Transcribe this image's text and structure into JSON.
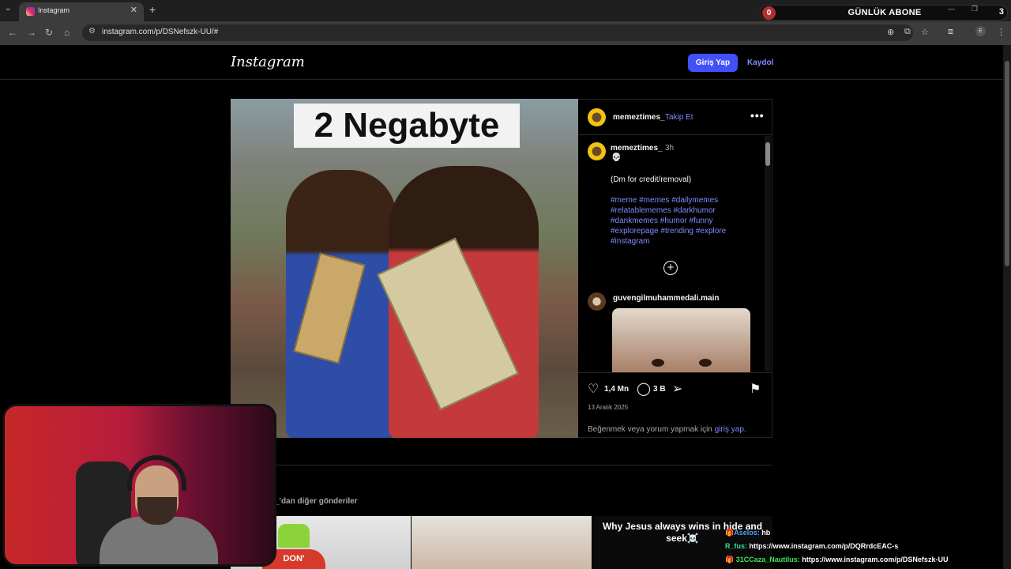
{
  "browser": {
    "tab_title": "Instagram",
    "url": "instagram.com/p/DSNefszk-UU/#"
  },
  "subscriber_overlay": {
    "left_count": "0",
    "title": "GÜNLÜK ABONE",
    "right_count": "3"
  },
  "header": {
    "logo": "Instagram",
    "login_label": "Giriş Yap",
    "signup_label": "Kaydol"
  },
  "post": {
    "image_caption": "2 Negabyte",
    "username": "memeztimes_",
    "follow_label": "Takip Et",
    "more_label": "•••",
    "caption_user": "memeztimes_",
    "time": "3h",
    "emoji": "💀",
    "caption_text": "(Dm for credit/removal)",
    "hashtags": "#meme #memes #dailymemes #relatablememes #darkhumor #dankmemes #humor #funny #explorepage #trending #explore #instagram",
    "commenter": "guvengilmuhammedali.main",
    "likes": "1,4 Mn",
    "comments": "3 B",
    "date": "13 Aralık 2025",
    "login_note": "Beğenmek veya yorum yapmak için",
    "login_note_link": "giriş yap",
    "login_note_end": "."
  },
  "more_posts": {
    "label": "_'dan diğer gönderiler",
    "thumb1_text": "DON'",
    "thumb3_text": "Why Jesus always wins in hide and seek☠️"
  },
  "chat": [
    {
      "name": "🎁Aselos:",
      "text": "hb"
    },
    {
      "name": "R_fus:",
      "text": "https://www.instagram.com/p/DQRrdcEAC-s"
    },
    {
      "name": "🎁 31CCaza_Nautilus:",
      "text": "https://www.instagram.com/p/DSNefszk-UU"
    }
  ]
}
